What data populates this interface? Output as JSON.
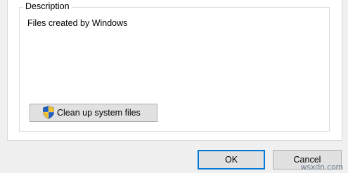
{
  "description_group": {
    "legend": "Description",
    "text": "Files created by Windows"
  },
  "cleanup_button": {
    "label": "Clean up system files",
    "icon": "uac-shield-icon"
  },
  "dialog_buttons": {
    "ok_label": "OK",
    "cancel_label": "Cancel"
  },
  "watermark": "wsxdn.com",
  "colors": {
    "focus_border": "#0078d7",
    "button_face": "#e1e1e1",
    "dialog_bg": "#f0f0f0",
    "pane_bg": "#ffffff"
  }
}
